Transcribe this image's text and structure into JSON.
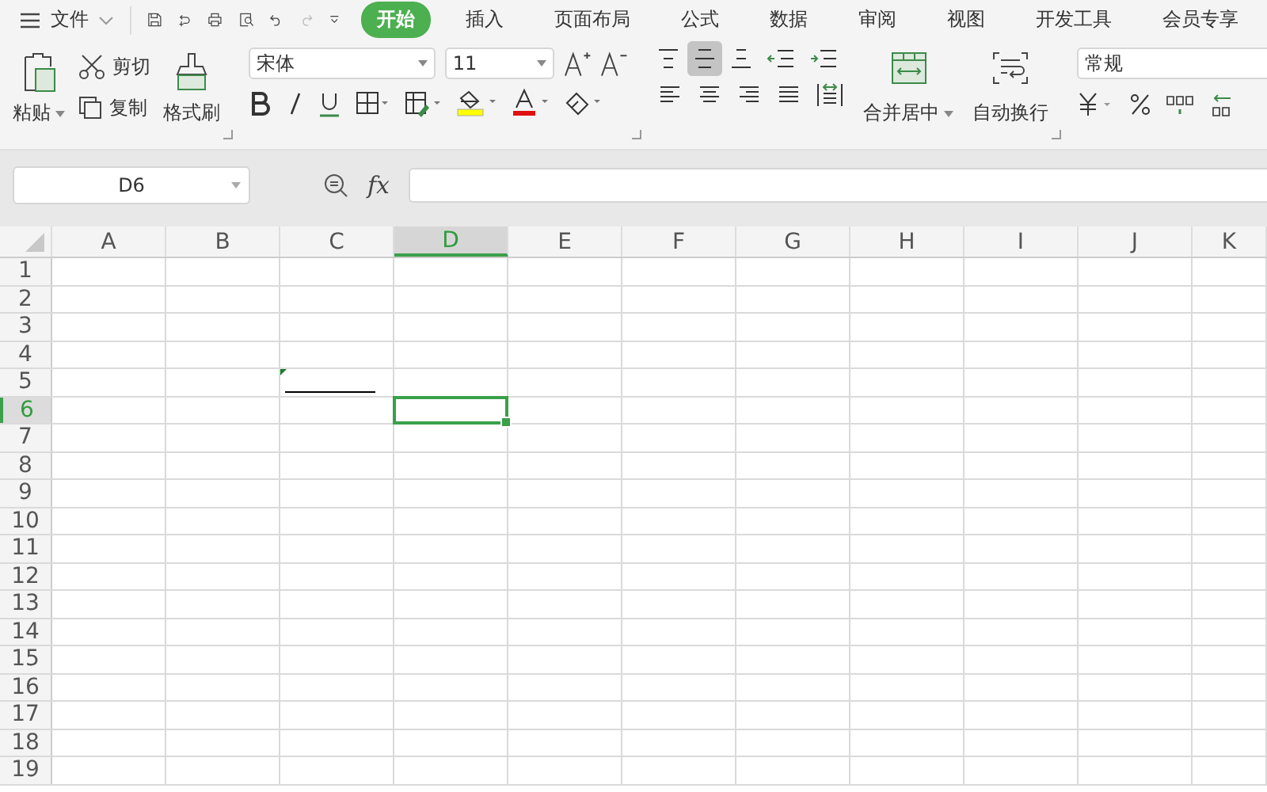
{
  "menu_bar": {
    "file_menu": "文件",
    "tabs": [
      {
        "label": "开始",
        "selected": true
      },
      {
        "label": "插入",
        "selected": false
      },
      {
        "label": "页面布局",
        "selected": false
      },
      {
        "label": "公式",
        "selected": false
      },
      {
        "label": "数据",
        "selected": false
      },
      {
        "label": "审阅",
        "selected": false
      },
      {
        "label": "视图",
        "selected": false
      },
      {
        "label": "开发工具",
        "selected": false
      },
      {
        "label": "会员专享",
        "selected": false
      }
    ]
  },
  "ribbon": {
    "paste": "粘贴",
    "cut": "剪切",
    "copy": "复制",
    "format_painter": "格式刷",
    "font_name": "宋体",
    "font_size": "11",
    "vertical_align": [
      {
        "kind": "top",
        "selected": false
      },
      {
        "kind": "middle",
        "selected": true
      },
      {
        "kind": "bottom",
        "selected": false
      }
    ],
    "merge_center": "合并居中",
    "wrap_text": "自动换行",
    "number_format": "常规"
  },
  "formula_bar": {
    "cell_reference": "D6",
    "fx": "fx"
  },
  "sheet": {
    "columns": [
      {
        "label": "A",
        "selected": false,
        "marked": false
      },
      {
        "label": "B",
        "selected": false,
        "marked": false
      },
      {
        "label": "C",
        "selected": false,
        "marked": true
      },
      {
        "label": "D",
        "selected": true,
        "marked": false
      },
      {
        "label": "E",
        "selected": false,
        "marked": false
      },
      {
        "label": "F",
        "selected": false,
        "marked": false
      },
      {
        "label": "G",
        "selected": false,
        "marked": false
      },
      {
        "label": "H",
        "selected": false,
        "marked": false
      },
      {
        "label": "I",
        "selected": false,
        "marked": false
      },
      {
        "label": "J",
        "selected": false,
        "marked": false
      },
      {
        "label": "K",
        "selected": false,
        "marked": false
      }
    ],
    "rows": [
      {
        "label": "1",
        "selected": false,
        "marked": false
      },
      {
        "label": "2",
        "selected": false,
        "marked": false
      },
      {
        "label": "3",
        "selected": false,
        "marked": false
      },
      {
        "label": "4",
        "selected": false,
        "marked": false
      },
      {
        "label": "5",
        "selected": false,
        "marked": true
      },
      {
        "label": "6",
        "selected": true,
        "marked": false
      },
      {
        "label": "7",
        "selected": false,
        "marked": false
      },
      {
        "label": "8",
        "selected": false,
        "marked": false
      },
      {
        "label": "9",
        "selected": false,
        "marked": false
      },
      {
        "label": "10",
        "selected": false,
        "marked": false
      },
      {
        "label": "11",
        "selected": false,
        "marked": false
      },
      {
        "label": "12",
        "selected": false,
        "marked": false
      },
      {
        "label": "13",
        "selected": false,
        "marked": false
      },
      {
        "label": "14",
        "selected": false,
        "marked": false
      },
      {
        "label": "15",
        "selected": false,
        "marked": false
      },
      {
        "label": "16",
        "selected": false,
        "marked": false
      },
      {
        "label": "17",
        "selected": false,
        "marked": false
      },
      {
        "label": "18",
        "selected": false,
        "marked": false
      },
      {
        "label": "19",
        "selected": false,
        "marked": false
      }
    ]
  }
}
